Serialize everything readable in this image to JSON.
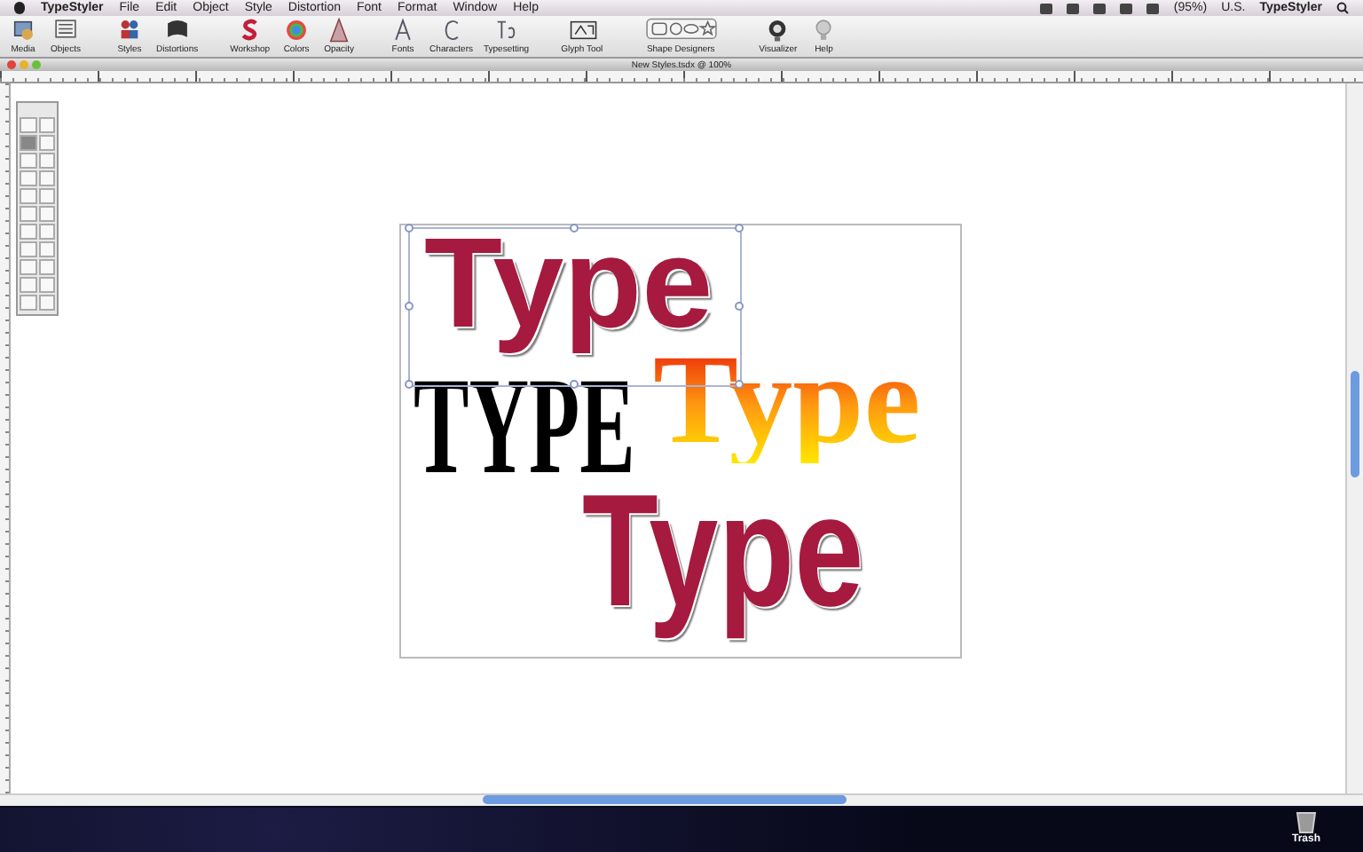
{
  "menu_bar": {
    "app_name": "TypeStyler",
    "items": [
      "File",
      "Edit",
      "Object",
      "Style",
      "Distortion",
      "Font",
      "Format",
      "Window",
      "Help"
    ],
    "battery": "(95%)",
    "input_source": "U.S.",
    "active_app": "TypeStyler"
  },
  "toolbar": [
    {
      "label": "Media",
      "kind": "media"
    },
    {
      "label": "Objects",
      "kind": "objects"
    },
    {
      "label": "Styles",
      "kind": "styles"
    },
    {
      "label": "Distortions",
      "kind": "distortions"
    },
    {
      "label": "Workshop",
      "kind": "workshop"
    },
    {
      "label": "Colors",
      "kind": "colors"
    },
    {
      "label": "Opacity",
      "kind": "opacity"
    },
    {
      "label": "Fonts",
      "kind": "fonts"
    },
    {
      "label": "Characters",
      "kind": "characters"
    },
    {
      "label": "Typesetting",
      "kind": "typesetting"
    },
    {
      "label": "Glyph Tool",
      "kind": "glyph"
    },
    {
      "label": "Shape Designers",
      "kind": "shapes"
    },
    {
      "label": "Visualizer",
      "kind": "visualizer"
    },
    {
      "label": "Help",
      "kind": "help"
    }
  ],
  "window": {
    "title": "New Styles.tsdx @ 100%"
  },
  "artwork": [
    {
      "text": "Type",
      "kind": "glitter",
      "selected": true
    },
    {
      "text": "TYPE",
      "kind": "slab",
      "selected": false
    },
    {
      "text": "Type",
      "kind": "gradient",
      "selected": false
    },
    {
      "text": "Type",
      "kind": "glitter-large",
      "selected": false
    }
  ],
  "dock": {
    "label": "Trash"
  }
}
